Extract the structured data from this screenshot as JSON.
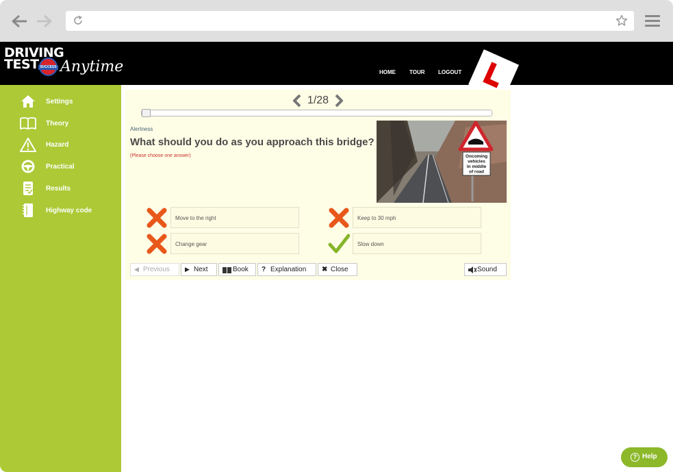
{
  "browser": {
    "url": "",
    "back_icon": "arrow-left-icon",
    "forward_icon": "arrow-right-icon",
    "reload_icon": "reload-icon",
    "bookmark_icon": "star-icon",
    "menu_icon": "hamburger-menu-icon"
  },
  "brand": {
    "line1": "DRIVING",
    "line2": "TEST",
    "badge": "SUCCESS",
    "script": "Anytime"
  },
  "topnav": {
    "home": "HOME",
    "tour": "TOUR",
    "logout": "LOGOUT"
  },
  "sidebar": {
    "items": [
      {
        "label": "Settings",
        "icon": "home-icon"
      },
      {
        "label": "Theory",
        "icon": "book-icon"
      },
      {
        "label": "Hazard",
        "icon": "warning-icon"
      },
      {
        "label": "Practical",
        "icon": "steering-wheel-icon"
      },
      {
        "label": "Results",
        "icon": "results-icon"
      },
      {
        "label": "Highway code",
        "icon": "notebook-icon"
      }
    ]
  },
  "question": {
    "counter": "1/28",
    "current": 1,
    "total": 28,
    "progress": 0.0,
    "category": "Alertness",
    "text": "What should you do as you approach this bridge?",
    "instruction": "(Please choose one answer)",
    "sign_text": [
      "Oncoming",
      "vehicles",
      "in middle",
      "of road"
    ],
    "answers": [
      {
        "text": "Move to the right",
        "mark": "cross-icon"
      },
      {
        "text": "Keep to 30 mph",
        "mark": "cross-icon"
      },
      {
        "text": "Change gear",
        "mark": "cross-icon"
      },
      {
        "text": "Slow down",
        "mark": "check-icon"
      }
    ]
  },
  "toolbar": {
    "previous": "Previous",
    "next": "Next",
    "book": "Book",
    "explanation": "Explanation",
    "close": "Close",
    "sound": "Sound"
  },
  "help": {
    "label": "Help"
  },
  "colors": {
    "sidebar_green": "#adc936",
    "header_black": "#000000",
    "panel_cream": "#fefde6",
    "wrong_orange": "#e8581a",
    "correct_green": "#86b52a",
    "help_green": "#8cb82a"
  }
}
